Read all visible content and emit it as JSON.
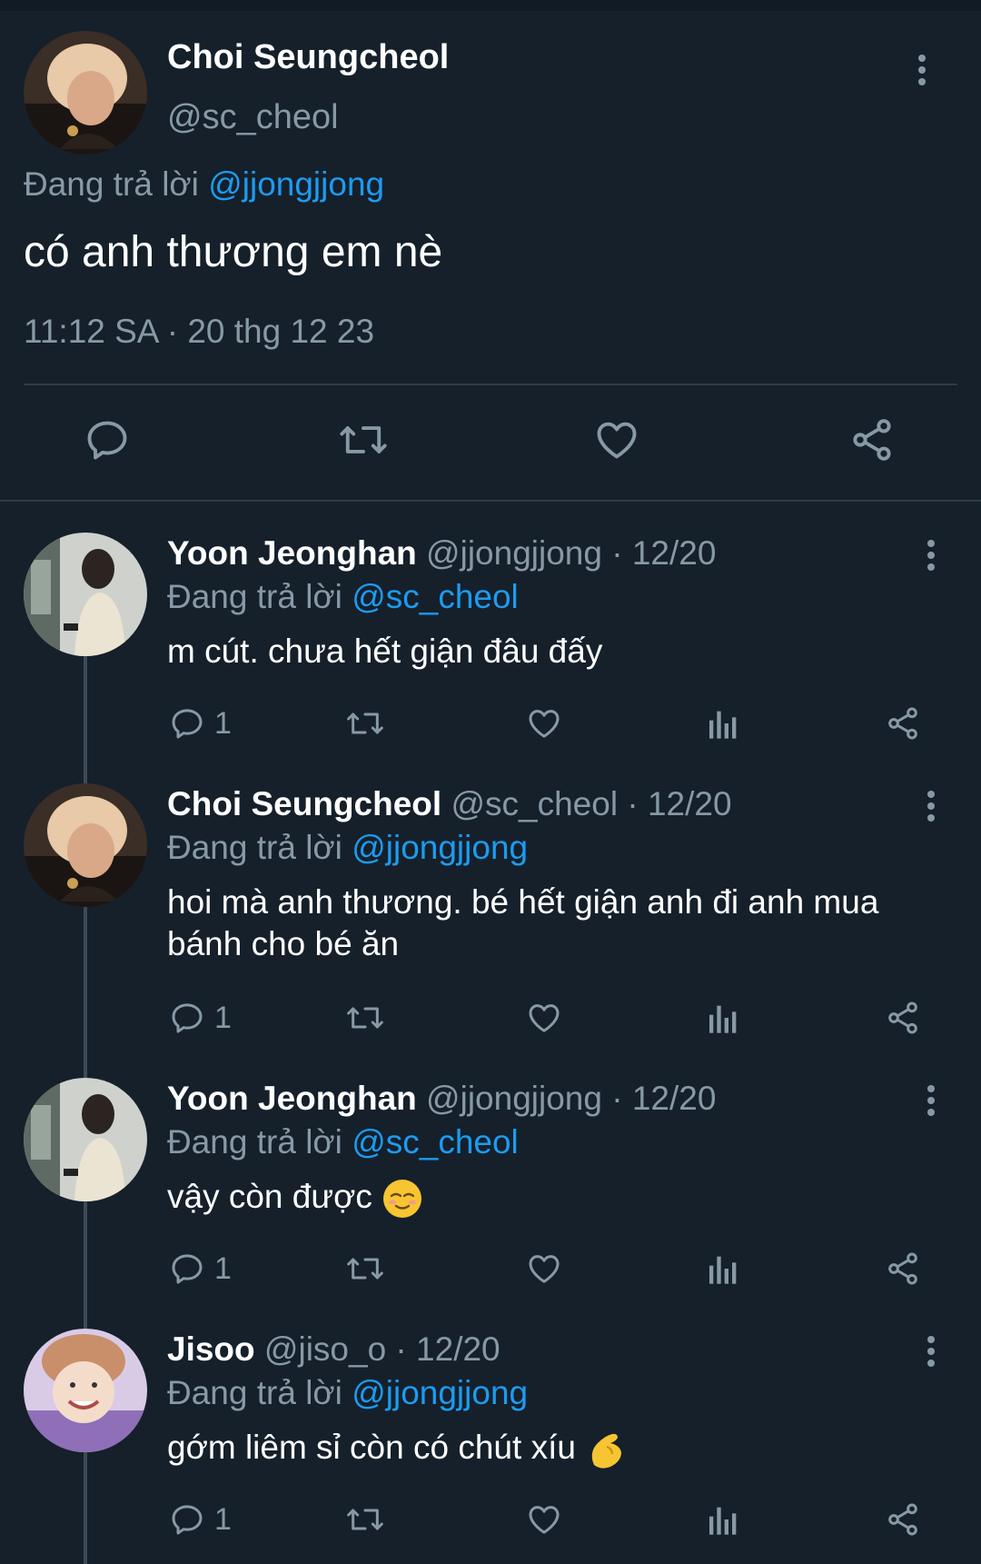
{
  "main_tweet": {
    "author_name": "Choi Seungcheol",
    "author_handle": "@sc_cheol",
    "replying_prefix": "Đang trả lời",
    "replying_to": "@jjongjjong",
    "text": "có anh thương em nè",
    "timestamp": "11:12 SA · 20 thg 12 23"
  },
  "replies": [
    {
      "author_name": "Yoon Jeonghan",
      "meta": "@jjongjjong · 12/20",
      "replying_prefix": "Đang trả lời",
      "replying_to": "@sc_cheol",
      "text": "m cút. chưa hết giận đâu đấy",
      "reply_count": "1"
    },
    {
      "author_name": "Choi Seungcheol",
      "meta": "@sc_cheol · 12/20",
      "replying_prefix": "Đang trả lời",
      "replying_to": "@jjongjjong",
      "text": "hoi mà anh thương. bé hết giận anh đi anh mua bánh cho bé ăn",
      "reply_count": "1"
    },
    {
      "author_name": "Yoon Jeonghan",
      "meta": "@jjongjjong · 12/20",
      "replying_prefix": "Đang trả lời",
      "replying_to": "@sc_cheol",
      "text": "vậy còn được",
      "emoji": "relieved-face-emoji",
      "reply_count": "1"
    },
    {
      "author_name": "Jisoo",
      "meta": "@jiso_o · 12/20",
      "replying_prefix": "Đang trả lời",
      "replying_to": "@jjongjjong",
      "text": "gớm liêm sỉ còn có chút xíu",
      "emoji": "pinching-hand-emoji",
      "reply_count": "1"
    }
  ],
  "colors": {
    "background": "#15202b",
    "muted_text": "#8899a6",
    "link": "#1d9bf0",
    "divider": "#2f3b47"
  }
}
